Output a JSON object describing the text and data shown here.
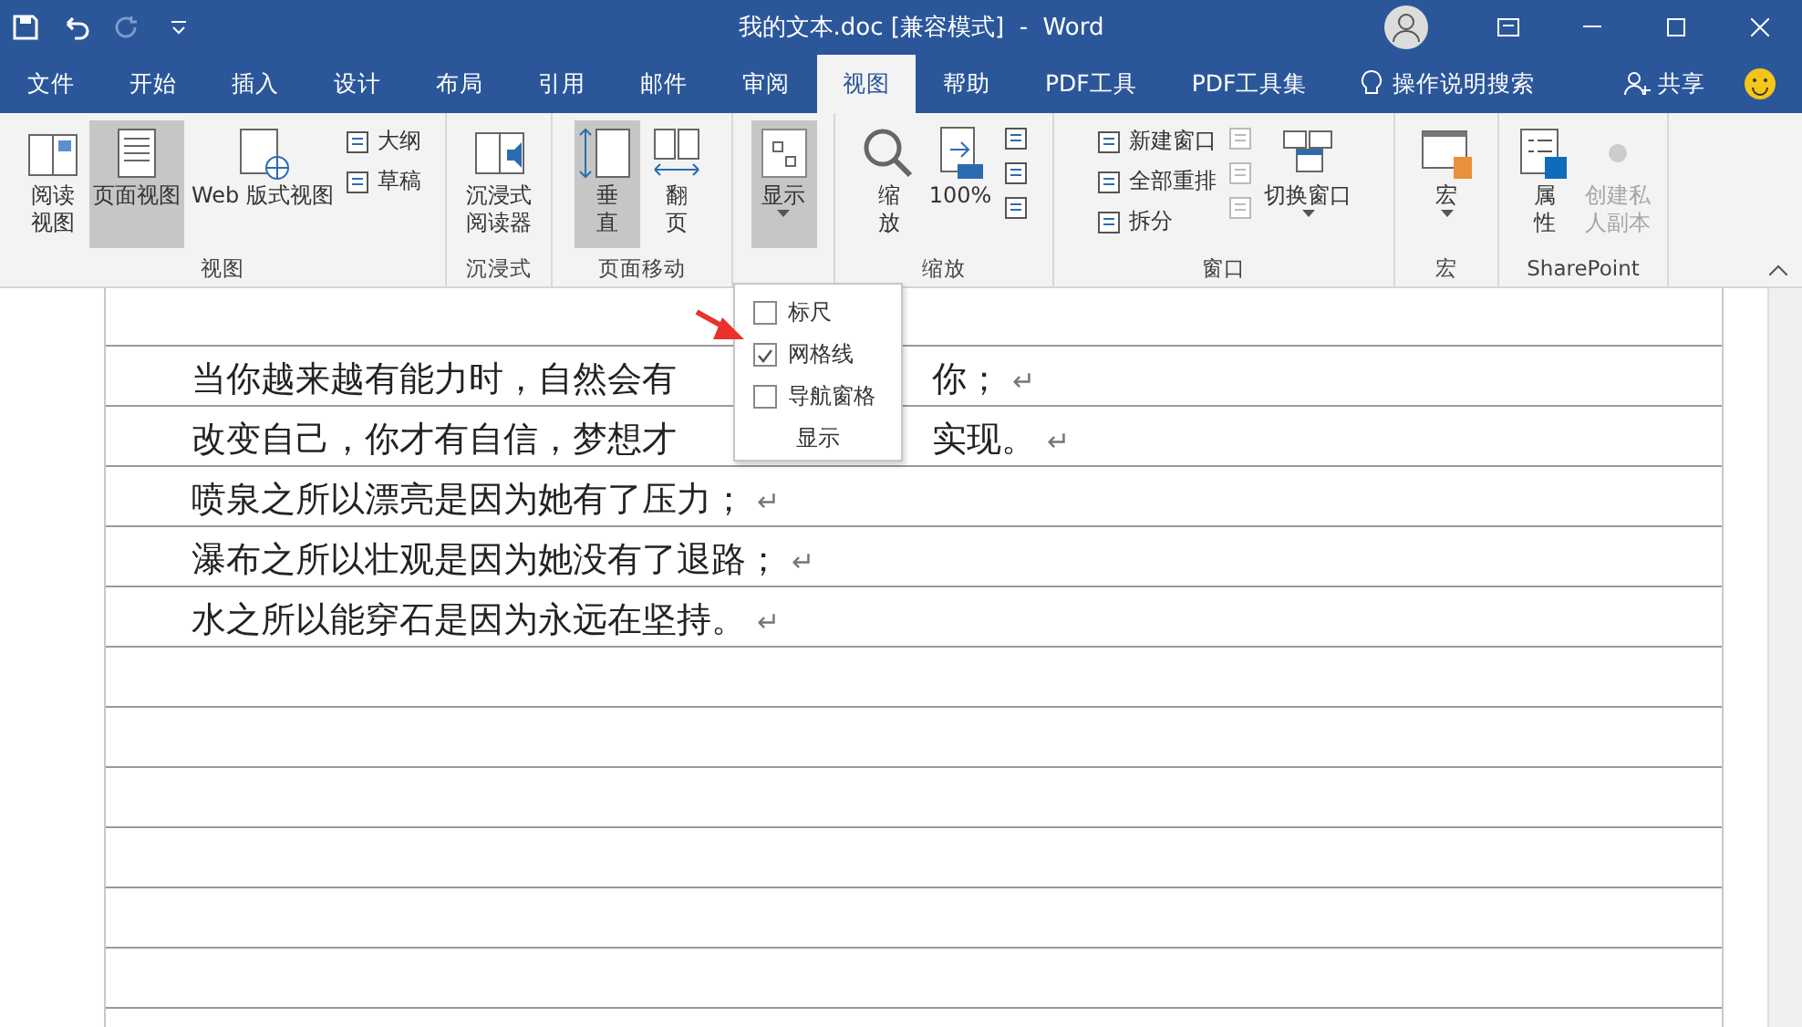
{
  "window": {
    "title": "我的文本.doc [兼容模式]  -  Word"
  },
  "tabs": [
    {
      "label": "文件",
      "selected": false
    },
    {
      "label": "开始",
      "selected": false
    },
    {
      "label": "插入",
      "selected": false
    },
    {
      "label": "设计",
      "selected": false
    },
    {
      "label": "布局",
      "selected": false
    },
    {
      "label": "引用",
      "selected": false
    },
    {
      "label": "邮件",
      "selected": false
    },
    {
      "label": "审阅",
      "selected": false
    },
    {
      "label": "视图",
      "selected": true
    },
    {
      "label": "帮助",
      "selected": false
    },
    {
      "label": "PDF工具",
      "selected": false
    },
    {
      "label": "PDF工具集",
      "selected": false
    }
  ],
  "tell_me": "操作说明搜索",
  "share": "共享",
  "ribbon": [
    {
      "label": "视图",
      "items": [
        {
          "kind": "large2",
          "label": "阅读视图",
          "selected": false
        },
        {
          "kind": "large",
          "label": "页面视图",
          "selected": true
        },
        {
          "kind": "large",
          "label": "Web 版式视图",
          "selected": false
        },
        {
          "kind": "stack",
          "items": [
            {
              "label": "大纲",
              "disabled": false
            },
            {
              "label": "草稿",
              "disabled": false
            }
          ]
        }
      ]
    },
    {
      "label": "沉浸式",
      "items": [
        {
          "kind": "large2",
          "label": "沉浸式阅读器",
          "selected": false
        }
      ]
    },
    {
      "label": "页面移动",
      "items": [
        {
          "kind": "large2",
          "label": "垂直",
          "selected": true
        },
        {
          "kind": "large2",
          "label": "翻页",
          "selected": false
        }
      ]
    },
    {
      "items": [
        {
          "kind": "large",
          "label": "显示",
          "selected": true,
          "menu": true
        }
      ]
    },
    {
      "label": "缩放",
      "items": [
        {
          "kind": "large2",
          "label": "缩放",
          "selected": false
        },
        {
          "kind": "large",
          "label": "100%",
          "selected": false
        },
        {
          "kind": "stack",
          "items": [
            {
              "disabled": false
            },
            {
              "disabled": false
            },
            {
              "disabled": false
            }
          ]
        }
      ]
    },
    {
      "label": "窗口",
      "items": [
        {
          "kind": "stack",
          "items": [
            {
              "label": "新建窗口",
              "disabled": false
            },
            {
              "label": "全部重排",
              "disabled": false
            },
            {
              "label": "拆分",
              "disabled": false
            }
          ]
        },
        {
          "kind": "stack",
          "items": [
            {
              "disabled": true
            },
            {
              "disabled": true
            },
            {
              "disabled": true
            }
          ]
        },
        {
          "kind": "large",
          "label": "切换窗口",
          "selected": false,
          "menu": true
        }
      ]
    },
    {
      "label": "宏",
      "items": [
        {
          "kind": "large",
          "label": "宏",
          "selected": false,
          "menu": true
        }
      ]
    },
    {
      "label": "SharePoint",
      "items": [
        {
          "kind": "large2",
          "label": "属性",
          "selected": false
        },
        {
          "kind": "large2",
          "label": "创建私人副本",
          "selected": false,
          "disabled": true
        }
      ]
    }
  ],
  "display_menu": {
    "items": [
      {
        "label": "标尺",
        "checked": false
      },
      {
        "label": "网格线",
        "checked": true
      },
      {
        "label": "导航窗格",
        "checked": false
      }
    ],
    "footer": "显示"
  },
  "document": {
    "lines": [
      {
        "parts": [
          "当你越来越有能力时，自然会有",
          "你；"
        ]
      },
      {
        "parts": [
          "改变自己，你才有自信，梦想才",
          "实现。"
        ]
      },
      {
        "parts": [
          "喷泉之所以漂亮是因为她有了压力；"
        ]
      },
      {
        "parts": [
          "瀑布之所以壮观是因为她没有了退路；"
        ]
      },
      {
        "parts": [
          "水之所以能穿石是因为永远在坚持。"
        ]
      }
    ],
    "paragraph_mark": "↵"
  }
}
